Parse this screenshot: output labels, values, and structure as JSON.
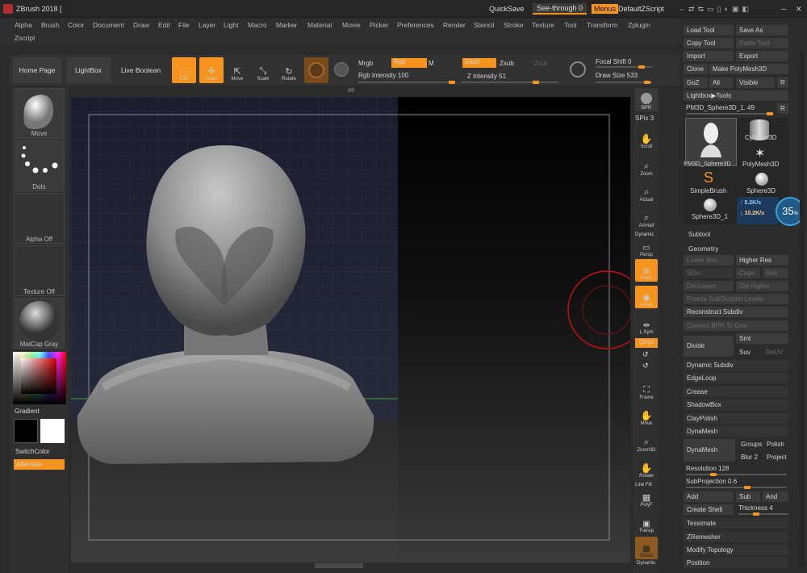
{
  "app": {
    "title": "ZBrush 2018 [",
    "quicksave": "QuickSave",
    "see_through": "See-through  0",
    "menus": "Menus",
    "script": "DefaultZScript"
  },
  "menu": {
    "row1": [
      "Alpha",
      "Brush",
      "Color",
      "Document",
      "Draw",
      "Edit",
      "File",
      "Layer",
      "Light",
      "Macro",
      "Marker",
      "Material",
      "Movie",
      "Picker",
      "Preferences",
      "Render",
      "Stencil",
      "Stroke",
      "Texture",
      "Tool",
      "Transform",
      "Zplugin"
    ],
    "row2": [
      "Zscript"
    ]
  },
  "toolbar": {
    "home": "Home Page",
    "lightbox": "LightBox",
    "live_boolean": "Live Boolean",
    "edit": "Edit",
    "draw": "Draw",
    "move": "Move",
    "scale": "Scale",
    "rotate": "Rotate",
    "mrgb": "Mrgb",
    "rgb": "Rgb",
    "m": "M",
    "zadd": "Zadd",
    "zsub": "Zsub",
    "zcut": "Zcut",
    "rgb_intensity": "Rgb Intensity 100",
    "z_intensity": "Z Intensity 51",
    "focal_shift": "Focal Shift 0",
    "draw_size": "Draw Size 533",
    "rgb_intensity_value": 100,
    "z_intensity_value": 51,
    "focal_shift_value": 0,
    "draw_size_value": 533
  },
  "left": {
    "brush": "Move",
    "stroke": "Dots",
    "alpha": "Alpha Off",
    "texture": "Texture Off",
    "material": "MatCap Gray",
    "gradient": "Gradient",
    "switch": "SwitchColor",
    "alternate": "Alternate"
  },
  "right": {
    "bpr": "BPR",
    "spix": "SPix 3",
    "scroll": "Scroll",
    "zoom": "Zoom",
    "actual": "Actual",
    "aahalf": "AAHalf",
    "dynamic": "Dynamic",
    "persp": "Persp",
    "floor": "Floor",
    "local": "Local",
    "lsym": "L.Sym",
    "xyz": "Qxyz",
    "frame": "Frame",
    "move": "Move",
    "zoom3d": "Zoom3D",
    "rotate": "Rotate",
    "linefill": "Line Fill",
    "polyf": "PolyF",
    "transp": "Transp",
    "ghost": "Ghost",
    "dynamic2": "Dynamic"
  },
  "tool": {
    "load": "Load Tool",
    "saveas": "Save As",
    "copy": "Copy Tool",
    "paste": "Paste Tool",
    "import": "Import",
    "export": "Export",
    "clone": "Clone",
    "make_polymesh": "Make PolyMesh3D",
    "goz": "GoZ",
    "all": "All",
    "visible": "Visible",
    "r": "R",
    "lightbox_tools": "Lightbox▶Tools",
    "current": "PM3D_Sphere3D_1. 49",
    "thumbs": [
      "PM3D_Sphere3D",
      "Cylinder3D",
      "PolyMesh3D",
      "SimpleBrush",
      "Sphere3D",
      "Sphere3D_1"
    ],
    "net_up": "5.2K/s",
    "net_down": "10.2K/s",
    "net_pct": "35",
    "net_unit": "%"
  },
  "subtool": {
    "label": "Subtool",
    "geometry": "Geometry",
    "lower_res": "Lower Res",
    "higher_res": "Higher Res",
    "sdiv": "SDiv",
    "cage": "Cage",
    "rstr": "Rstr",
    "del_lower": "Del Lower",
    "del_higher": "Del Higher",
    "freeze": "Freeze SubDivision Levels",
    "reconstruct": "Reconstruct Subdiv",
    "convert_bpr": "Convert BPR To Geo",
    "divide": "Divide",
    "smt": "Smt",
    "suv": "Suv",
    "reuv": "ReUV",
    "dynamic_subdiv": "Dynamic Subdiv",
    "edgeloop": "EdgeLoop",
    "crease": "Crease",
    "shadowbox": "ShadowBox",
    "claypolish": "ClayPolish",
    "dynamesh_head": "DynaMesh",
    "dynamesh_btn": "DynaMesh",
    "groups": "Groups",
    "polish": "Polish",
    "blur": "Blur 2",
    "project": "Project",
    "resolution": "Resolution 128",
    "subprojection": "SubProjection 0.6",
    "add": "Add",
    "sub": "Sub",
    "and": "And",
    "create_shell": "Create Shell",
    "thickness": "Thickness 4",
    "tessimate": "Tessimate",
    "zremesher": "ZRemesher",
    "modify_topology": "Modify Topology",
    "position": "Position",
    "resolution_value": 128,
    "subprojection_value": 0.6,
    "blur_value": 2,
    "thickness_value": 4
  }
}
